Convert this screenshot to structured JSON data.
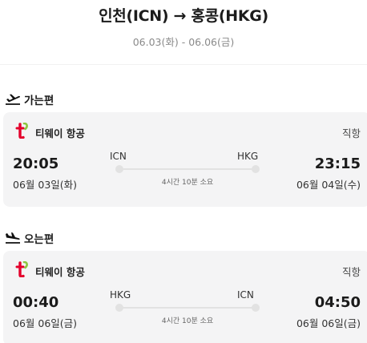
{
  "header": {
    "title": "인천(ICN) → 홍콩(HKG)",
    "dates": "06.03(화) - 06.06(금)"
  },
  "outbound": {
    "section_label": "가는편",
    "section_icon": "plane-takeoff-icon",
    "airline": "티웨이 항공",
    "flight_type": "직항",
    "dep_time": "20:05",
    "dep_date": "06월 03일(화)",
    "from": "ICN",
    "to": "HKG",
    "duration": "4시간 10분 소요",
    "arr_time": "23:15",
    "arr_date": "06월 04일(수)"
  },
  "inbound": {
    "section_label": "오는편",
    "section_icon": "plane-landing-icon",
    "airline": "티웨이 항공",
    "flight_type": "직항",
    "dep_time": "00:40",
    "dep_date": "06월 06일(금)",
    "from": "HKG",
    "to": "ICN",
    "duration": "4시간 10분 소요",
    "arr_time": "04:50",
    "arr_date": "06월 06일(금)"
  },
  "colors": {
    "logo_red": "#e4002b",
    "logo_green": "#8dc63f",
    "card_bg": "#f4f4f5"
  }
}
